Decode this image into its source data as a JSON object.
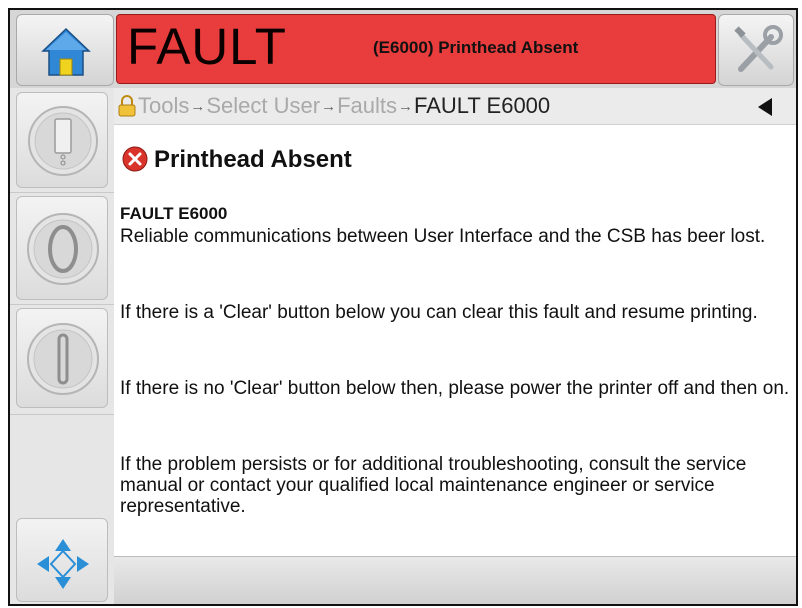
{
  "header": {
    "fault_title": "FAULT",
    "fault_message": "(E6000) Printhead Absent"
  },
  "icons": {
    "home": "home-icon",
    "tools": "tools-icon",
    "nav": "four-way-arrow-icon"
  },
  "colors": {
    "fault_banner": "#e93c3c",
    "nav_arrows": "#2b8fd8"
  },
  "breadcrumb": {
    "items": [
      "Tools",
      "Select User",
      "Faults"
    ],
    "current": "FAULT E6000",
    "separator": "→"
  },
  "fault": {
    "heading": "Printhead Absent",
    "code": "FAULT E6000",
    "paragraphs": [
      "Reliable communications between User Interface and the CSB has beer lost.",
      "If there is a 'Clear' button below you can clear this fault and resume printing.",
      "If there is no 'Clear' button below then, please power the printer off and then on.",
      "If the problem persists or for additional troubleshooting, consult the service manual or contact your qualified local maintenance engineer or service representative."
    ]
  }
}
